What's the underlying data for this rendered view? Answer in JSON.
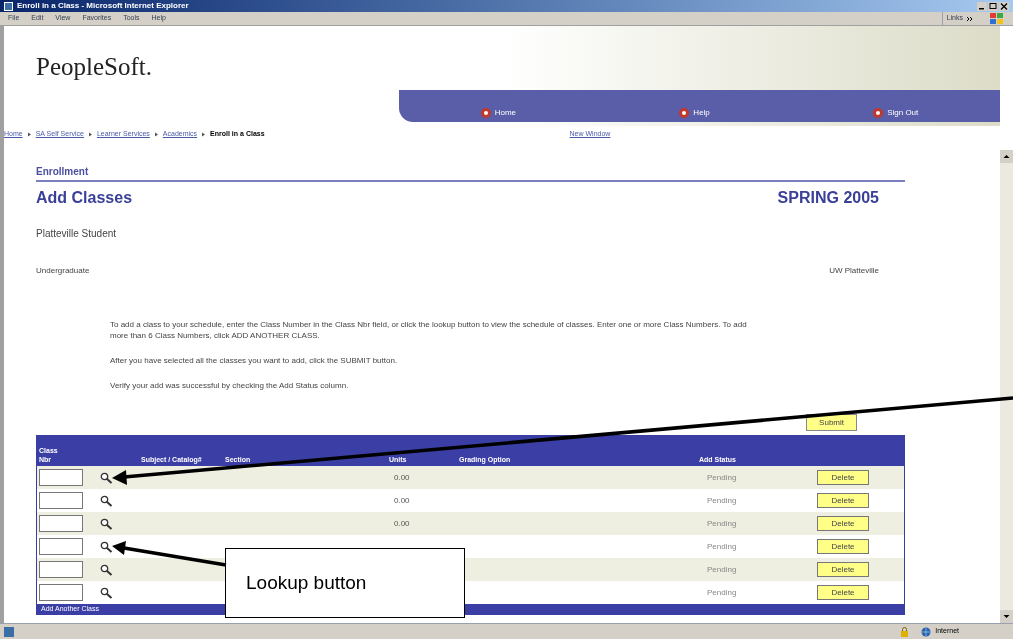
{
  "window": {
    "title": "Enroll in a Class - Microsoft Internet Explorer"
  },
  "menu": [
    "File",
    "Edit",
    "View",
    "Favorites",
    "Tools",
    "Help"
  ],
  "links_label": "Links",
  "header": {
    "logo": "PeopleSoft.",
    "nav": [
      "Home",
      "Help",
      "Sign Out"
    ]
  },
  "breadcrumb": [
    {
      "label": "Home",
      "current": false
    },
    {
      "label": "SA Self Service",
      "current": false
    },
    {
      "label": "Learner Services",
      "current": false
    },
    {
      "label": "Academics",
      "current": false
    },
    {
      "label": "Enroll in a Class",
      "current": true
    }
  ],
  "new_window": "New Window",
  "section": "Enrollment",
  "heading": "Add Classes",
  "term": "SPRING 2005",
  "student": "Platteville Student",
  "career": "Undergraduate",
  "institution": "UW Platteville",
  "instructions": [
    "To add a class to your schedule, enter the Class Number in the Class Nbr field, or click the lookup button to view the schedule of classes. Enter one or more Class Numbers. To add more than 6 Class Numbers, click ADD ANOTHER CLASS.",
    "After you have selected all the classes you want to add, click the SUBMIT button.",
    "Verify your add was successful by checking the Add Status column."
  ],
  "submit": "Submit",
  "table": {
    "columns": [
      "Class Nbr",
      "Subject / Catalog#",
      "Section",
      "Units",
      "Grading Option",
      "Add Status"
    ],
    "rows": [
      {
        "units": "0.00",
        "status": "Pending",
        "action": "Delete"
      },
      {
        "units": "0.00",
        "status": "Pending",
        "action": "Delete"
      },
      {
        "units": "0.00",
        "status": "Pending",
        "action": "Delete"
      },
      {
        "status": "Pending",
        "action": "Delete"
      },
      {
        "status": "Pending",
        "action": "Delete"
      },
      {
        "status": "Pending",
        "action": "Delete"
      }
    ],
    "footer": "Add Another Class"
  },
  "status_bar": {
    "zone": "Internet"
  },
  "callout": {
    "text": "Lookup button"
  }
}
